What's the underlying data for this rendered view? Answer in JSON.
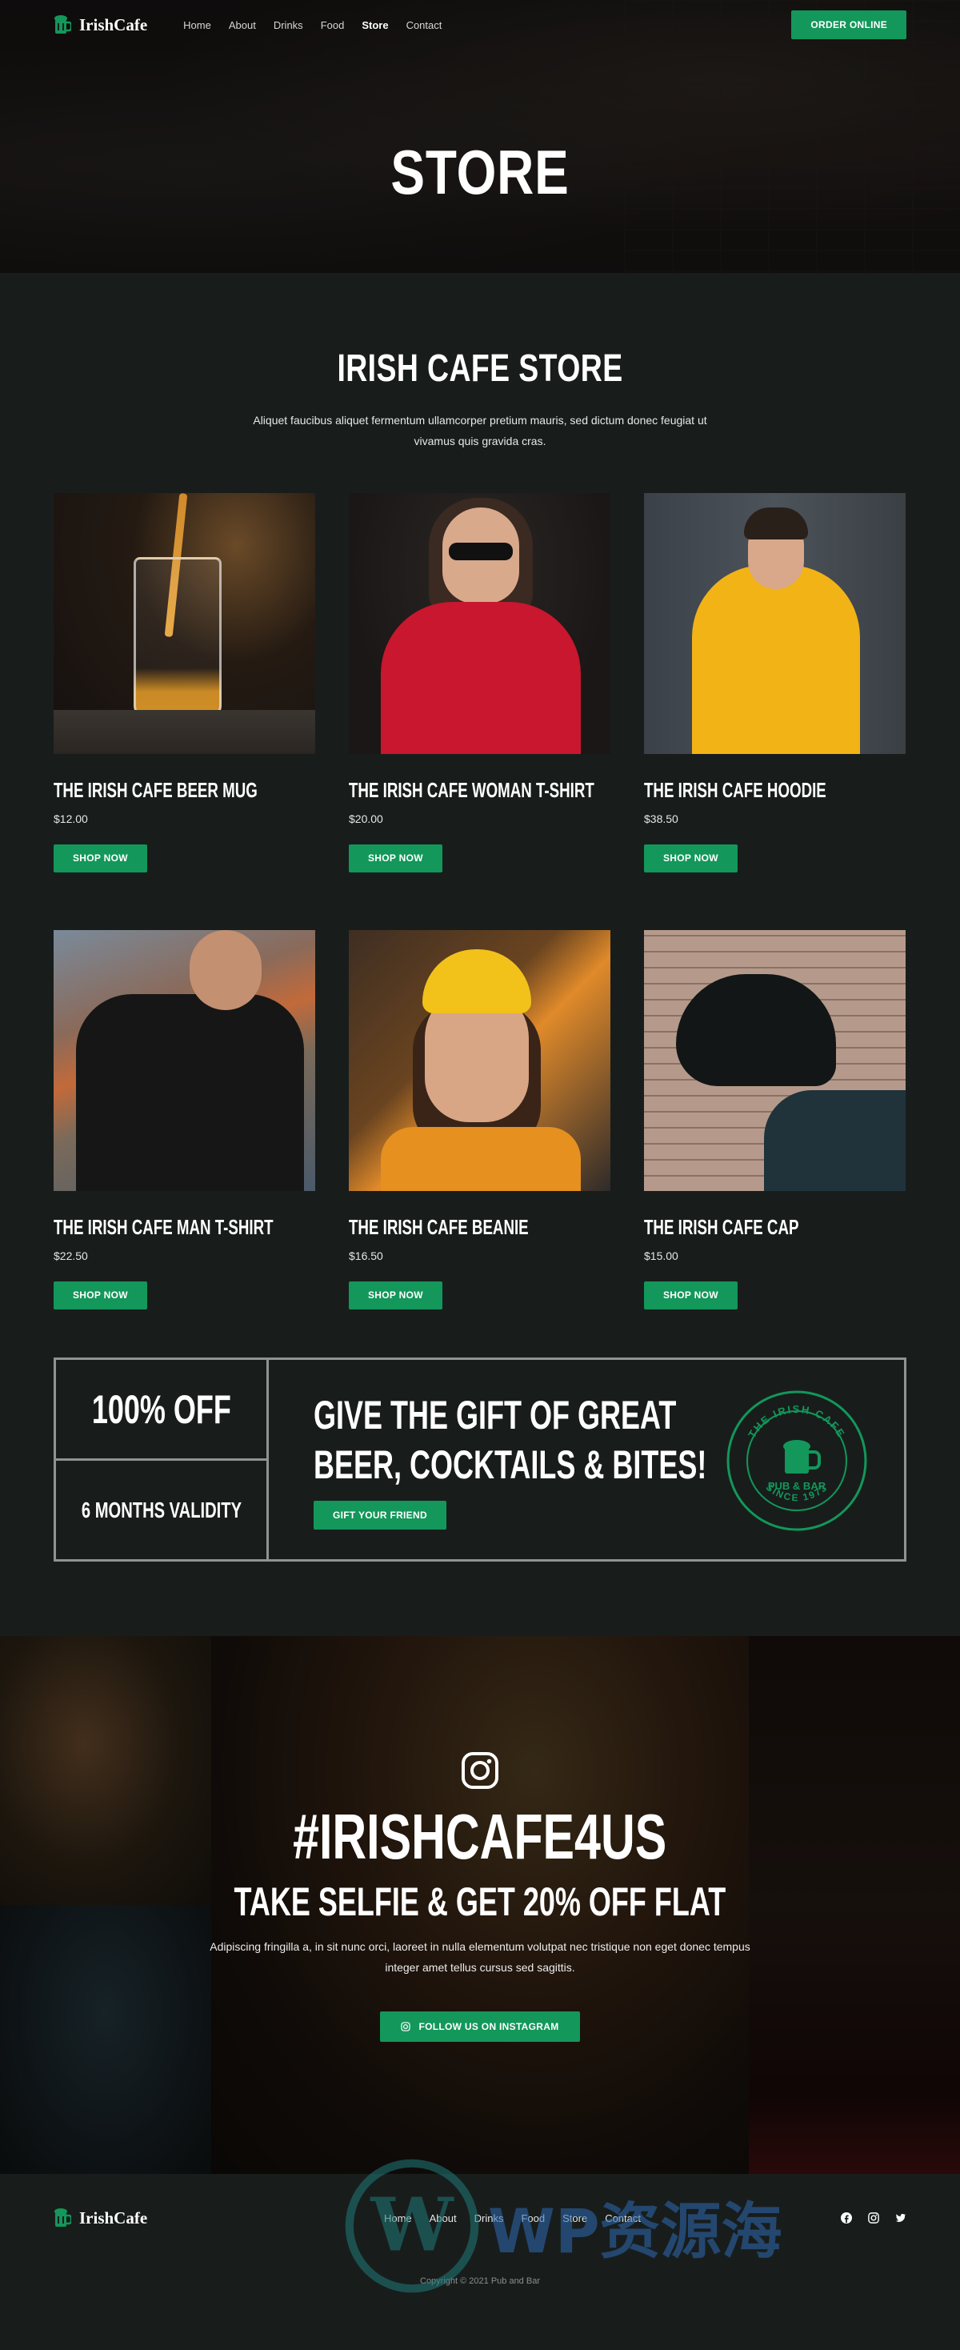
{
  "brand": {
    "name": "IrishCafe",
    "accent": "#13975a"
  },
  "nav": {
    "items": [
      "Home",
      "About",
      "Drinks",
      "Food",
      "Store",
      "Contact"
    ],
    "active": "Store",
    "order_button": "ORDER ONLINE"
  },
  "hero": {
    "title": "STORE"
  },
  "store": {
    "title": "IRISH CAFE STORE",
    "intro": "Aliquet faucibus aliquet fermentum ullamcorper pretium mauris, sed dictum donec feugiat ut vivamus quis gravida cras.",
    "products": [
      {
        "name": "THE IRISH CAFE BEER MUG",
        "price": "$12.00",
        "button": "SHOP NOW"
      },
      {
        "name": "THE IRISH CAFE WOMAN T-SHIRT",
        "price": "$20.00",
        "button": "SHOP NOW"
      },
      {
        "name": "THE IRISH CAFE HOODIE",
        "price": "$38.50",
        "button": "SHOP NOW"
      },
      {
        "name": "THE IRISH CAFE MAN T-SHIRT",
        "price": "$22.50",
        "button": "SHOP NOW"
      },
      {
        "name": "THE IRISH CAFE BEANIE",
        "price": "$16.50",
        "button": "SHOP NOW"
      },
      {
        "name": "THE IRISH CAFE CAP",
        "price": "$15.00",
        "button": "SHOP NOW"
      }
    ]
  },
  "promo": {
    "discount": "100% OFF",
    "validity": "6 MONTHS VALIDITY",
    "headline_line1": "GIVE THE GIFT OF GREAT",
    "headline_line2": "BEER, COCKTAILS & BITES!",
    "button": "GIFT YOUR FRIEND",
    "badge": {
      "top": "THE IRISH CAFE",
      "middle": "PUB & BAR",
      "bottom": "SINCE 1973"
    }
  },
  "instagram": {
    "hashtag": "#IRISHCAFE4US",
    "subtitle": "TAKE SELFIE & GET 20% OFF FLAT",
    "description": "Adipiscing fringilla a, in sit nunc orci, laoreet in nulla elementum volutpat nec tristique non eget donec tempus integer amet tellus cursus sed sagittis.",
    "button": "FOLLOW US ON INSTAGRAM"
  },
  "footer": {
    "brand": "IrishCafe",
    "items": [
      "Home",
      "About",
      "Drinks",
      "Food",
      "Store",
      "Contact"
    ],
    "social": [
      "facebook-icon",
      "instagram-icon",
      "twitter-icon"
    ],
    "copyright": "Copyright © 2021 Pub and Bar",
    "watermark": "WP资源海"
  }
}
